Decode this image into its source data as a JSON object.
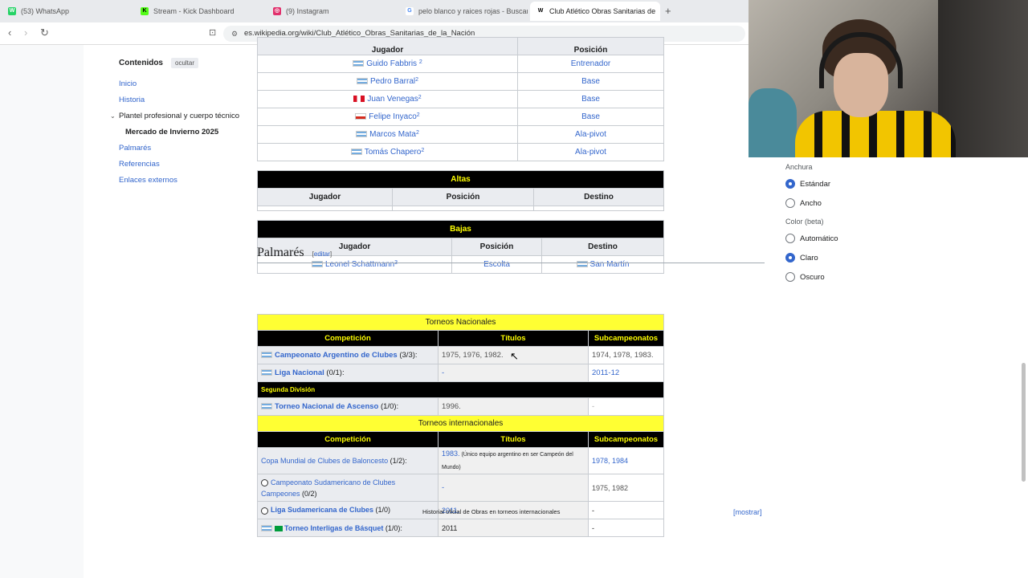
{
  "tabs": [
    {
      "label": "(53) WhatsApp",
      "color": "#25d366",
      "glyph": "W"
    },
    {
      "label": "Stream - Kick Dashboard",
      "color": "#53fc18",
      "glyph": "K"
    },
    {
      "label": "(9) Instagram",
      "color": "#e1306c",
      "glyph": "◎"
    },
    {
      "label": "pelo blanco y raices rojas - Buscar co",
      "color": "#ffffff",
      "glyph": "G"
    },
    {
      "label": "Club Atlético Obras Sanitarias de",
      "color": "#ffffff",
      "glyph": "W"
    }
  ],
  "url": "es.wikipedia.org/wiki/Club_Atlético_Obras_Sanitarias_de_la_Nación",
  "toc": {
    "title": "Contenidos",
    "hide": "ocultar",
    "items": [
      "Inicio",
      "Historia",
      "Plantel profesional y cuerpo técnico",
      "Mercado de Invierno 2025",
      "Palmarés",
      "Referencias",
      "Enlaces externos"
    ]
  },
  "staff_table": {
    "header": [
      "Jugador",
      "Posición"
    ],
    "rows": [
      {
        "name": "Guido Fabbris",
        "ref": "2",
        "pos": "Entrenador",
        "flag": "ar"
      },
      {
        "name": "Pedro Barral",
        "ref": "2",
        "pos": "Base",
        "flag": "ar"
      },
      {
        "name": "Juan Venegas",
        "ref": "2",
        "pos": "Base",
        "flag": "pe"
      },
      {
        "name": "Felipe Inyaco",
        "ref": "2",
        "pos": "Base",
        "flag": "cl"
      },
      {
        "name": "Marcos Mata",
        "ref": "2",
        "pos": "Ala-pivot",
        "flag": "ar"
      },
      {
        "name": "Tomás Chapero",
        "ref": "2",
        "pos": "Ala-pivot",
        "flag": "ar"
      }
    ]
  },
  "altas": {
    "title": "Altas",
    "header": [
      "Jugador",
      "Posición",
      "Destino"
    ]
  },
  "bajas": {
    "title": "Bajas",
    "header": [
      "Jugador",
      "Posición",
      "Destino"
    ],
    "row": {
      "name": "Leonel Schattmann",
      "ref": "3",
      "pos": "Escolta",
      "dest": "San Martín"
    }
  },
  "palmares": {
    "heading": "Palmarés",
    "edit": "editar",
    "nacionales": "Torneos Nacionales",
    "header": [
      "Competición",
      "Títulos",
      "Subcampeonatos"
    ],
    "segunda": "Segunda División",
    "internacionales": "Torneos internacionales",
    "rows_nac": [
      {
        "comp": "Campeonato Argentino de Clubes",
        "count": " (3/3):",
        "titles": "1975, 1976, 1982.",
        "sub": "1974, 1978, 1983."
      },
      {
        "comp": "Liga Nacional",
        "count": " (0/1):",
        "titles": "-",
        "sub": "2011-12"
      }
    ],
    "row_ascenso": {
      "comp": "Torneo Nacional de Ascenso",
      "count": " (1/0):",
      "titles": "1996.",
      "sub": "-"
    },
    "rows_int": [
      {
        "comp": "Copa Mundial de Clubes de Baloncesto",
        "count": " (1/2):",
        "titles": "1983.",
        "note": " (Único equipo argentino en ser Campeón del Mundo)",
        "sub": "1978, 1984"
      },
      {
        "comp": "Campeonato Sudamericano de Clubes Campeones",
        "count": " (0/2)",
        "titles": "-",
        "note": "",
        "sub": "1975, 1982"
      },
      {
        "comp": "Liga Sudamericana de Clubes",
        "count": " (1/0)",
        "titles": "2011.",
        "note": "",
        "sub": "-"
      },
      {
        "comp": "Torneo Interligas de Básquet",
        "count": " (1/0):",
        "titles": "2011",
        "note": "",
        "sub": "-"
      }
    ]
  },
  "footer": {
    "caption": "Historial oficial de Obras en torneos internacionales",
    "show": "[mostrar]"
  },
  "appearance": {
    "width_label": "Anchura",
    "width_options": [
      "Estándar",
      "Ancho"
    ],
    "color_label": "Color (beta)",
    "color_options": [
      "Automático",
      "Claro",
      "Oscuro"
    ]
  }
}
